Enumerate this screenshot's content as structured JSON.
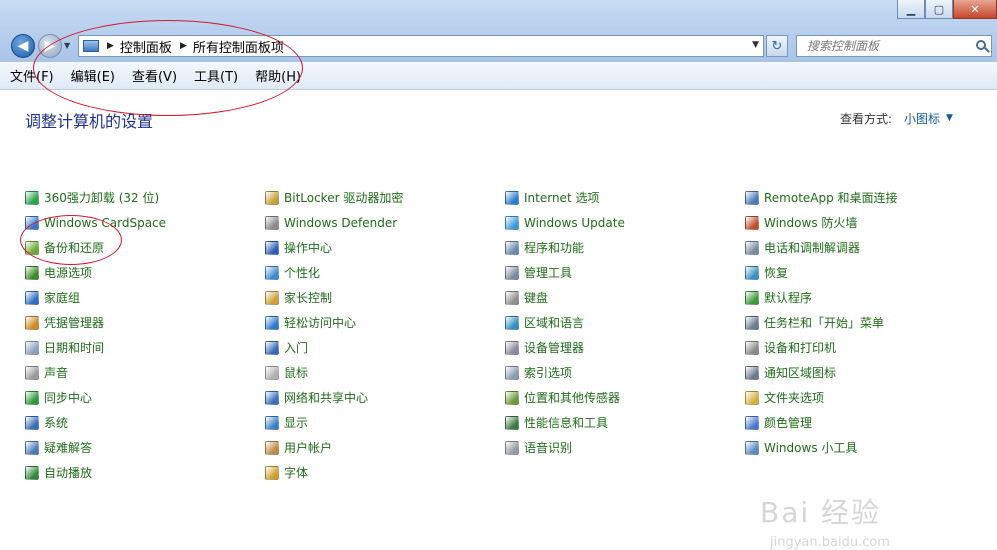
{
  "window": {
    "min_glyph": "▁",
    "max_glyph": "▢",
    "close_glyph": "✕"
  },
  "nav": {
    "back_glyph": "◀",
    "forward_glyph": "▶",
    "history_glyph": "▼",
    "breadcrumb": [
      "控制面板",
      "所有控制面板项"
    ],
    "crumb_separator": "▶",
    "address_dropdown_glyph": "▼",
    "refresh_glyph": "↻",
    "search_placeholder": "搜索控制面板"
  },
  "menubar": {
    "items": [
      "文件(F)",
      "编辑(E)",
      "查看(V)",
      "工具(T)",
      "帮助(H)"
    ]
  },
  "content": {
    "title": "调整计算机的设置",
    "view_label": "查看方式:",
    "view_value": "小图标",
    "view_arrow": "▼"
  },
  "columns": [
    {
      "items": [
        {
          "label": "360强力卸载 (32 位)",
          "icon": "uninstall-icon",
          "color": "#2aa44a"
        },
        {
          "label": "Windows CardSpace",
          "icon": "cardspace-icon",
          "color": "#3a78c8"
        },
        {
          "label": "备份和还原",
          "icon": "backup-icon",
          "color": "#6aa832"
        },
        {
          "label": "电源选项",
          "icon": "power-icon",
          "color": "#3d8a2c"
        },
        {
          "label": "家庭组",
          "icon": "homegroup-icon",
          "color": "#2f6fc2"
        },
        {
          "label": "凭据管理器",
          "icon": "credential-icon",
          "color": "#d08a22"
        },
        {
          "label": "日期和时间",
          "icon": "clock-icon",
          "color": "#8aa0c0"
        },
        {
          "label": "声音",
          "icon": "speaker-icon",
          "color": "#9a9a9a"
        },
        {
          "label": "同步中心",
          "icon": "sync-icon",
          "color": "#2e9a38"
        },
        {
          "label": "系统",
          "icon": "system-icon",
          "color": "#3a6cb8"
        },
        {
          "label": "疑难解答",
          "icon": "troubleshoot-icon",
          "color": "#4a7ab8"
        },
        {
          "label": "自动播放",
          "icon": "autoplay-icon",
          "color": "#2e8a3a"
        }
      ]
    },
    {
      "items": [
        {
          "label": "BitLocker 驱动器加密",
          "icon": "bitlocker-icon",
          "color": "#c9a03a"
        },
        {
          "label": "Windows Defender",
          "icon": "defender-icon",
          "color": "#8a8a8a"
        },
        {
          "label": "操作中心",
          "icon": "flag-icon",
          "color": "#2d5db8"
        },
        {
          "label": "个性化",
          "icon": "personalize-icon",
          "color": "#3a8ad0"
        },
        {
          "label": "家长控制",
          "icon": "parental-icon",
          "color": "#d0a03a"
        },
        {
          "label": "轻松访问中心",
          "icon": "ease-access-icon",
          "color": "#2f7ad0"
        },
        {
          "label": "入门",
          "icon": "getting-started-icon",
          "color": "#3a6ab8"
        },
        {
          "label": "鼠标",
          "icon": "mouse-icon",
          "color": "#b0b0b0"
        },
        {
          "label": "网络和共享中心",
          "icon": "network-icon",
          "color": "#3a70c0"
        },
        {
          "label": "显示",
          "icon": "display-icon",
          "color": "#3a80c8"
        },
        {
          "label": "用户帐户",
          "icon": "user-accounts-icon",
          "color": "#c08a40"
        },
        {
          "label": "字体",
          "icon": "font-icon",
          "color": "#d0a030"
        }
      ]
    },
    {
      "items": [
        {
          "label": "Internet 选项",
          "icon": "internet-icon",
          "color": "#2e7cd0"
        },
        {
          "label": "Windows Update",
          "icon": "update-icon",
          "color": "#3a9ad8"
        },
        {
          "label": "程序和功能",
          "icon": "programs-icon",
          "color": "#6a8ab0"
        },
        {
          "label": "管理工具",
          "icon": "admin-tools-icon",
          "color": "#7a8aa0"
        },
        {
          "label": "键盘",
          "icon": "keyboard-icon",
          "color": "#909090"
        },
        {
          "label": "区域和语言",
          "icon": "region-icon",
          "color": "#2e90c0"
        },
        {
          "label": "设备管理器",
          "icon": "device-manager-icon",
          "color": "#8a8a9a"
        },
        {
          "label": "索引选项",
          "icon": "index-icon",
          "color": "#8a9ab0"
        },
        {
          "label": "位置和其他传感器",
          "icon": "sensor-icon",
          "color": "#6a9a3a"
        },
        {
          "label": "性能信息和工具",
          "icon": "performance-icon",
          "color": "#3a7a40"
        },
        {
          "label": "语音识别",
          "icon": "microphone-icon",
          "color": "#909aa8"
        }
      ]
    },
    {
      "items": [
        {
          "label": "RemoteApp 和桌面连接",
          "icon": "remoteapp-icon",
          "color": "#4a7ab8"
        },
        {
          "label": "Windows 防火墙",
          "icon": "firewall-icon",
          "color": "#c0502a"
        },
        {
          "label": "电话和调制解调器",
          "icon": "modem-icon",
          "color": "#7a8aa0"
        },
        {
          "label": "恢复",
          "icon": "recovery-icon",
          "color": "#3a90c0"
        },
        {
          "label": "默认程序",
          "icon": "default-programs-icon",
          "color": "#3a9a3a"
        },
        {
          "label": "任务栏和「开始」菜单",
          "icon": "taskbar-icon",
          "color": "#6a7a90"
        },
        {
          "label": "设备和打印机",
          "icon": "printer-icon",
          "color": "#8a8a8a"
        },
        {
          "label": "通知区域图标",
          "icon": "notification-icon",
          "color": "#6a7a90"
        },
        {
          "label": "文件夹选项",
          "icon": "folder-icon",
          "color": "#d8b040"
        },
        {
          "label": "颜色管理",
          "icon": "color-management-icon",
          "color": "#4a7ad0"
        },
        {
          "label": "Windows 小工具",
          "icon": "gadgets-icon",
          "color": "#5a8ac0"
        }
      ]
    }
  ],
  "watermark": {
    "logo": "Bai 经验",
    "url": "jingyan.baidu.com"
  }
}
